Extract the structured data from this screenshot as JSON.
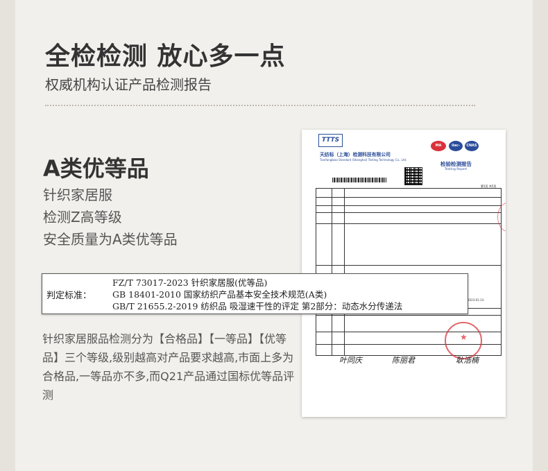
{
  "header": {
    "headline": "全检检测 放心多一点",
    "subhead": "权威机构认证产品检测报告"
  },
  "grade": {
    "title": "A类优等品",
    "features": [
      "针织家居服",
      "检测Z高等级",
      "安全质量为A类优等品"
    ]
  },
  "standards": {
    "label": "判定标准：",
    "lines": [
      "FZ/T 73017-2023  针织家居服(优等品)",
      "GB 18401-2010  国家纺织产品基本安全技术规范(A类)",
      "GB/T 21655.2-2019  纺织品 吸湿速干性的评定 第2部分：动态水分传递法"
    ]
  },
  "description": "针织家居服品检测分为【合格品】【一等品】【优等品】三个等级,级别越高对产品要求越高,市面上多为合格品,一等品亦不多,而Q21产品通过国标优等品评测",
  "certificate": {
    "logo": "TTTS",
    "org_name": "天纺标（上海）检测科技有限公司",
    "org_name_en": "Tianfangbiao Standard (Shanghai) Testing Technology Co., Ltd.",
    "badges": [
      "MA",
      "ilac-MRA",
      "CNAS"
    ],
    "report_title": "检验检测报告",
    "report_title_en": "Testing Report",
    "page": "第1页 共5页",
    "date": "2023-01-14",
    "signatures": [
      "叶同庆",
      "陈丽君",
      "耿浩楠"
    ],
    "colors": {
      "brand": "#2b4d9a",
      "stamp": "#d9323a"
    }
  }
}
